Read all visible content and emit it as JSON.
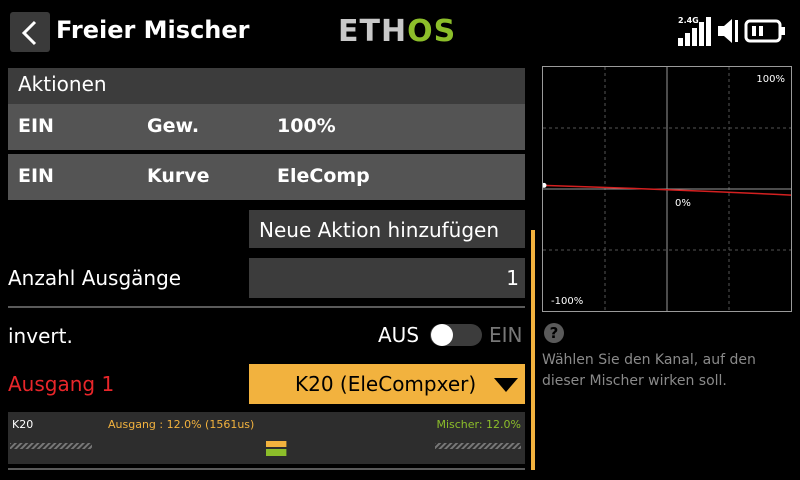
{
  "header": {
    "title": "Freier Mischer",
    "logo_left": "ETH",
    "logo_right": "OS",
    "signal_label": "2.4G"
  },
  "actions": {
    "section_title": "Aktionen",
    "rows": [
      {
        "state": "EIN",
        "type": "Gew.",
        "value": "100%"
      },
      {
        "state": "EIN",
        "type": "Kurve",
        "value": "EleComp"
      }
    ],
    "add_button": "Neue Aktion hinzufügen"
  },
  "outputs": {
    "count_label": "Anzahl Ausgänge",
    "count_value": "1"
  },
  "invert": {
    "label": "invert.",
    "off_label": "AUS",
    "on_label": "EIN",
    "enabled": false
  },
  "output1": {
    "label": "Ausgang 1",
    "channel": "K20 (EleCompxer)"
  },
  "monitor": {
    "channel": "K20",
    "output_text": "Ausgang : 12.0% (1561us)",
    "mixer_text": "Mischer: 12.0%",
    "output_fraction": 0.12,
    "mixer_fraction": 0.12
  },
  "graph": {
    "top_label": "100%",
    "mid_label": "0%",
    "bottom_label": "-100%",
    "curve_start": 3,
    "curve_end": -5
  },
  "help": {
    "icon": "question-icon",
    "text": "Wählen Sie den Kanal, auf den dieser Mischer wirken soll."
  },
  "colors": {
    "accent": "#f2b23e",
    "alert": "#e8262a",
    "mixer": "#8cbe2a",
    "curve": "#d42020"
  }
}
